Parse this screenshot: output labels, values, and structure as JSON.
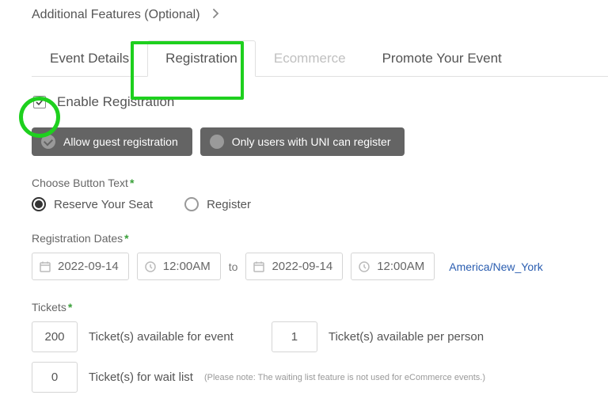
{
  "section_title": "Additional Features (Optional)",
  "tabs": {
    "event_details": "Event Details",
    "registration": "Registration",
    "ecommerce": "Ecommerce",
    "promote": "Promote Your Event"
  },
  "enable_label": "Enable Registration",
  "pill": {
    "guest": "Allow guest registration",
    "uni": "Only users with UNI can register"
  },
  "button_text": {
    "label": "Choose Button Text",
    "opt_reserve": "Reserve Your Seat",
    "opt_register": "Register"
  },
  "reg_dates": {
    "label": "Registration Dates",
    "start_date": "2022-09-14",
    "start_time": "12:00AM",
    "to": "to",
    "end_date": "2022-09-14",
    "end_time": "12:00AM",
    "tz": "America/New_York"
  },
  "tickets": {
    "label": "Tickets",
    "event_qty": "200",
    "event_lbl": "Ticket(s) available for event",
    "person_qty": "1",
    "person_lbl": "Ticket(s) available per person",
    "wait_qty": "0",
    "wait_lbl": "Ticket(s) for wait list",
    "wait_note": "(Please note: The waiting list feature is not used for eCommerce events.)"
  }
}
